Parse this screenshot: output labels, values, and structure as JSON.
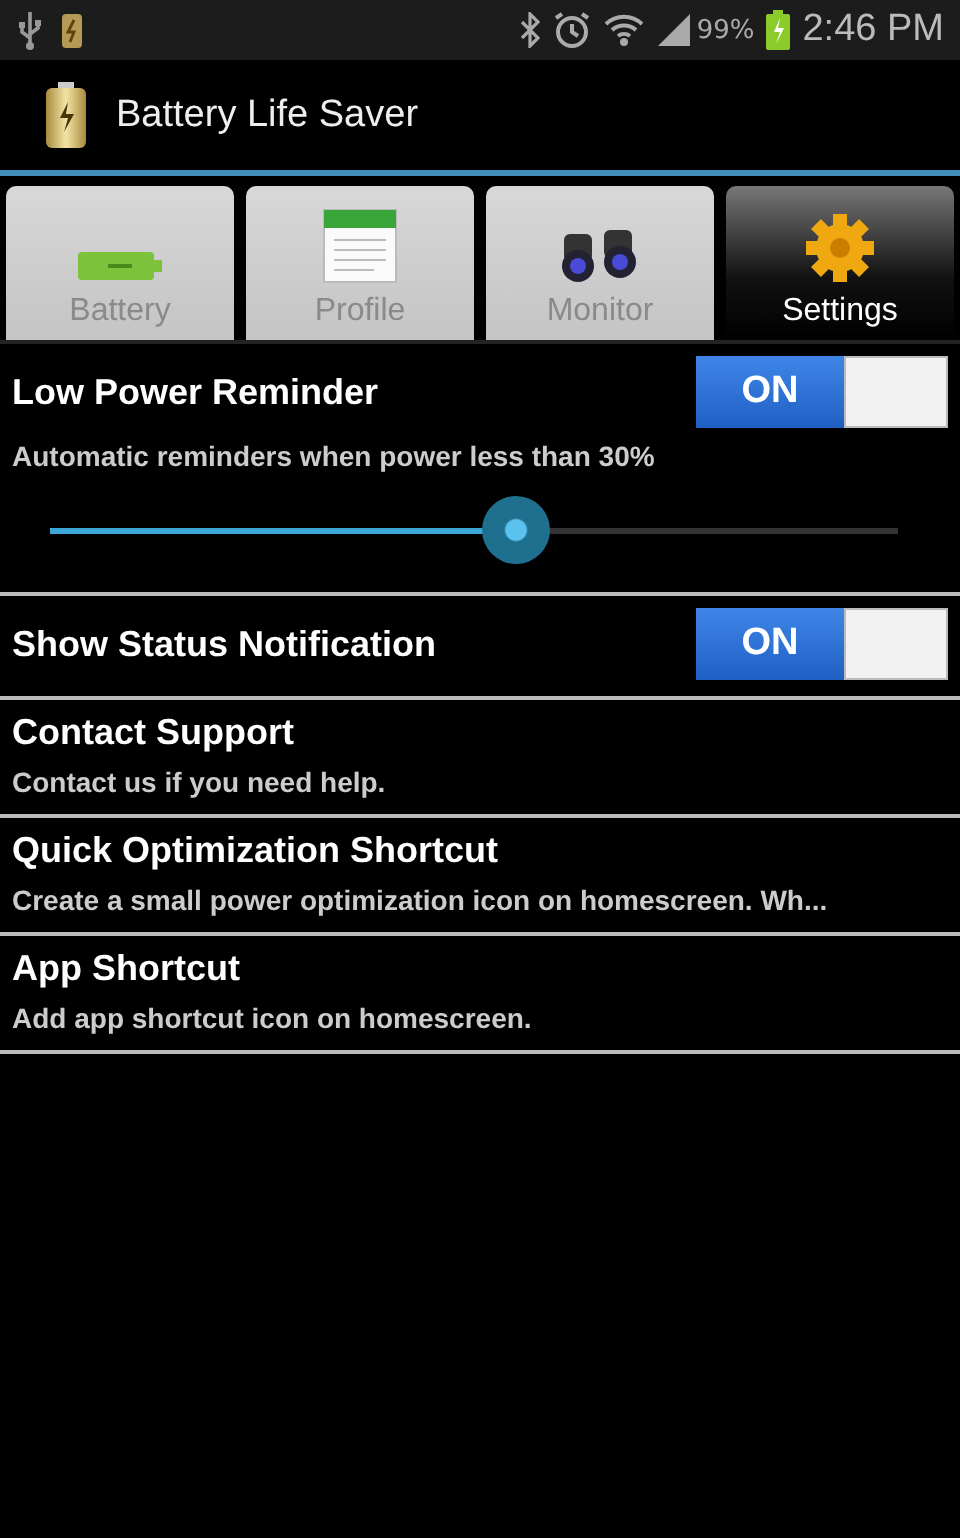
{
  "status_bar": {
    "battery_percent": "99%",
    "time": "2:46 PM"
  },
  "app_bar": {
    "title": "Battery Life Saver"
  },
  "tabs": [
    {
      "label": "Battery",
      "kind": "battery",
      "selected": false
    },
    {
      "label": "Profile",
      "kind": "calendar",
      "selected": false
    },
    {
      "label": "Monitor",
      "kind": "binoculars",
      "selected": false
    },
    {
      "label": "Settings",
      "kind": "gear",
      "selected": true
    }
  ],
  "settings": [
    {
      "kind": "switch",
      "title": "Low Power Reminder",
      "summary": "Automatic reminders when power less than 30%",
      "switch": {
        "label": "ON",
        "on": true
      },
      "slider": {
        "level": 0.55
      }
    },
    {
      "kind": "switch",
      "title": "Show Status Notification",
      "switch": {
        "label": "ON",
        "on": true
      }
    },
    {
      "kind": "text",
      "title": "Contact Support",
      "summary": "Contact us if you need help."
    },
    {
      "kind": "text",
      "title": "Quick Optimization Shortcut",
      "summary": "Create a small power optimization icon on homescreen. Wh..."
    },
    {
      "kind": "text",
      "title": "App Shortcut",
      "summary": "Add app shortcut icon on homescreen."
    }
  ]
}
